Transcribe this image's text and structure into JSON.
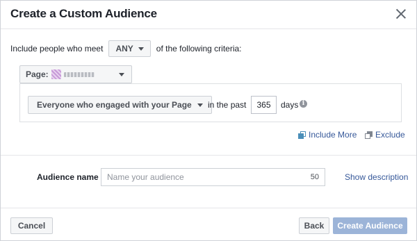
{
  "dialog": {
    "title": "Create a Custom Audience"
  },
  "criteria": {
    "prefix": "Include people who meet",
    "match_value": "ANY",
    "suffix": "of the following criteria:"
  },
  "source": {
    "page_label": "Page:"
  },
  "engagement": {
    "type_label": "Everyone who engaged with your Page",
    "in_past_label": "in the past",
    "days_value": "365",
    "days_label": "days"
  },
  "actions": {
    "include_more": "Include More",
    "exclude": "Exclude"
  },
  "audience_name": {
    "label": "Audience name",
    "placeholder": "Name your audience",
    "char_limit": "50",
    "show_description": "Show description"
  },
  "footer": {
    "cancel": "Cancel",
    "back": "Back",
    "create": "Create Audience"
  },
  "colors": {
    "link": "#365899",
    "primary_disabled": "#9cb4d8"
  }
}
